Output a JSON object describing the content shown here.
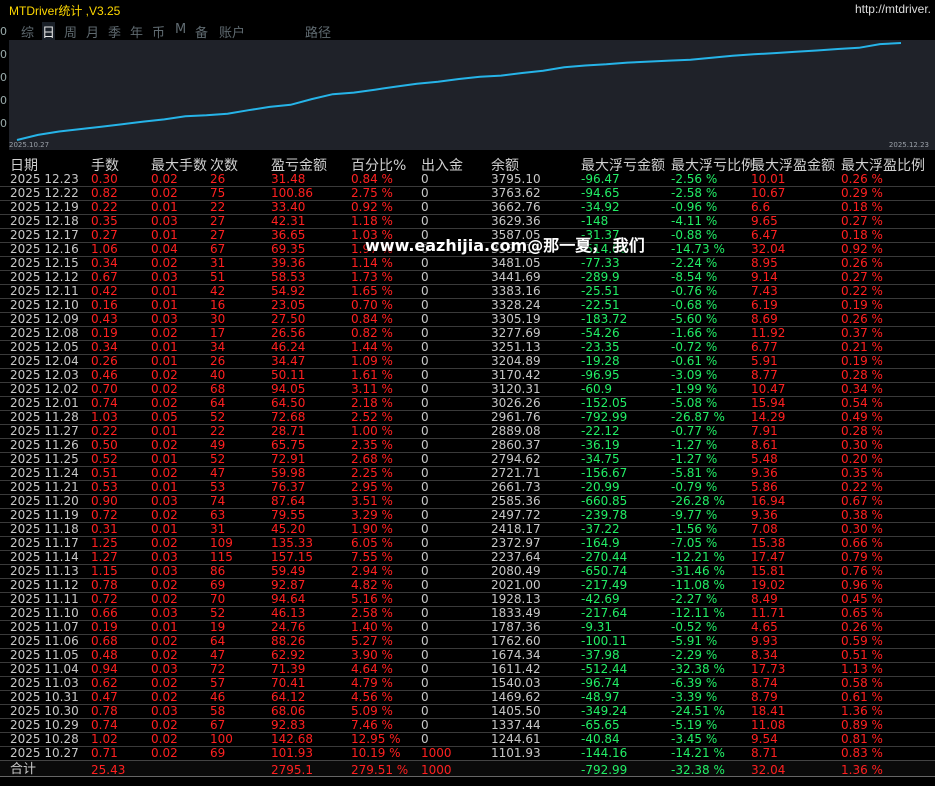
{
  "app": {
    "title": "MTDriver统计 ,V3.25",
    "url": "http://mtdriver."
  },
  "tabs": [
    {
      "label": "综"
    },
    {
      "label": "日",
      "active": true
    },
    {
      "label": "周"
    },
    {
      "label": "月"
    },
    {
      "label": "季"
    },
    {
      "label": "年"
    },
    {
      "label": "币"
    },
    {
      "label": "M"
    },
    {
      "label": "备"
    },
    {
      "label": "账户"
    },
    {
      "label": "路径"
    }
  ],
  "left_axis": [
    "0",
    "0",
    "0",
    "0",
    "0"
  ],
  "chart_data": {
    "type": "line",
    "x_start_label": "2025.10.27",
    "x_end_label": "2025.12.23",
    "line_color": "#26b4e8",
    "series": [
      {
        "values": [
          1101.93,
          1244.61,
          1337.44,
          1405.5,
          1469.62,
          1540.03,
          1611.42,
          1674.34,
          1762.6,
          1787.36,
          1833.49,
          1928.13,
          2021.0,
          2080.49,
          2237.64,
          2372.97,
          2418.17,
          2497.72,
          2585.36,
          2661.73,
          2721.71,
          2794.62,
          2860.37,
          2889.08,
          2961.76,
          3026.26,
          3120.31,
          3170.42,
          3204.89,
          3251.13,
          3277.69,
          3305.19,
          3328.24,
          3383.16,
          3441.69,
          3481.05,
          3514.36,
          3551.14,
          3587.05,
          3629.36,
          3662.76,
          3763.62,
          3795.1
        ]
      }
    ]
  },
  "table": {
    "headers": [
      "日期",
      "手数",
      "最大手数",
      "次数",
      "盈亏金额",
      "百分比%",
      "出入金",
      "余额",
      "最大浮亏金额",
      "最大浮亏比例",
      "最大浮盈金额",
      "最大浮盈比例"
    ],
    "rows": [
      [
        "2025 12.23",
        "0.30",
        "0.02",
        "26",
        "31.48",
        "0.84 %",
        "0",
        "3795.10",
        "-96.47",
        "-2.56 %",
        "10.01",
        "0.26 %"
      ],
      [
        "2025 12.22",
        "0.82",
        "0.02",
        "75",
        "100.86",
        "2.75 %",
        "0",
        "3763.62",
        "-94.65",
        "-2.58 %",
        "10.67",
        "0.29 %"
      ],
      [
        "2025 12.19",
        "0.22",
        "0.01",
        "22",
        "33.40",
        "0.92 %",
        "0",
        "3662.76",
        "-34.92",
        "-0.96 %",
        "6.6",
        "0.18 %"
      ],
      [
        "2025 12.18",
        "0.35",
        "0.03",
        "27",
        "42.31",
        "1.18 %",
        "0",
        "3629.36",
        "-148",
        "-4.11 %",
        "9.65",
        "0.27 %"
      ],
      [
        "2025 12.17",
        "0.27",
        "0.01",
        "27",
        "36.65",
        "1.03 %",
        "0",
        "3587.05",
        "-31.37",
        "-0.88 %",
        "6.47",
        "0.18 %"
      ],
      [
        "2025 12.16",
        "1.06",
        "0.04",
        "67",
        "69.35",
        "1.97 %",
        "0",
        "3551.14",
        "-514.00",
        "-14.73 %",
        "32.04",
        "0.92 %"
      ],
      [
        "2025 12.15",
        "0.34",
        "0.02",
        "31",
        "39.36",
        "1.14 %",
        "0",
        "3481.05",
        "-77.33",
        "-2.24 %",
        "8.95",
        "0.26 %"
      ],
      [
        "2025 12.12",
        "0.67",
        "0.03",
        "51",
        "58.53",
        "1.73 %",
        "0",
        "3441.69",
        "-289.9",
        "-8.54 %",
        "9.14",
        "0.27 %"
      ],
      [
        "2025 12.11",
        "0.42",
        "0.01",
        "42",
        "54.92",
        "1.65 %",
        "0",
        "3383.16",
        "-25.51",
        "-0.76 %",
        "7.43",
        "0.22 %"
      ],
      [
        "2025 12.10",
        "0.16",
        "0.01",
        "16",
        "23.05",
        "0.70 %",
        "0",
        "3328.24",
        "-22.51",
        "-0.68 %",
        "6.19",
        "0.19 %"
      ],
      [
        "2025 12.09",
        "0.43",
        "0.03",
        "30",
        "27.50",
        "0.84 %",
        "0",
        "3305.19",
        "-183.72",
        "-5.60 %",
        "8.69",
        "0.26 %"
      ],
      [
        "2025 12.08",
        "0.19",
        "0.02",
        "17",
        "26.56",
        "0.82 %",
        "0",
        "3277.69",
        "-54.26",
        "-1.66 %",
        "11.92",
        "0.37 %"
      ],
      [
        "2025 12.05",
        "0.34",
        "0.01",
        "34",
        "46.24",
        "1.44 %",
        "0",
        "3251.13",
        "-23.35",
        "-0.72 %",
        "6.77",
        "0.21 %"
      ],
      [
        "2025 12.04",
        "0.26",
        "0.01",
        "26",
        "34.47",
        "1.09 %",
        "0",
        "3204.89",
        "-19.28",
        "-0.61 %",
        "5.91",
        "0.19 %"
      ],
      [
        "2025 12.03",
        "0.46",
        "0.02",
        "40",
        "50.11",
        "1.61 %",
        "0",
        "3170.42",
        "-96.95",
        "-3.09 %",
        "8.77",
        "0.28 %"
      ],
      [
        "2025 12.02",
        "0.70",
        "0.02",
        "68",
        "94.05",
        "3.11 %",
        "0",
        "3120.31",
        "-60.9",
        "-1.99 %",
        "10.47",
        "0.34 %"
      ],
      [
        "2025 12.01",
        "0.74",
        "0.02",
        "64",
        "64.50",
        "2.18 %",
        "0",
        "3026.26",
        "-152.05",
        "-5.08 %",
        "15.94",
        "0.54 %"
      ],
      [
        "2025 11.28",
        "1.03",
        "0.05",
        "52",
        "72.68",
        "2.52 %",
        "0",
        "2961.76",
        "-792.99",
        "-26.87 %",
        "14.29",
        "0.49 %"
      ],
      [
        "2025 11.27",
        "0.22",
        "0.01",
        "22",
        "28.71",
        "1.00 %",
        "0",
        "2889.08",
        "-22.12",
        "-0.77 %",
        "7.91",
        "0.28 %"
      ],
      [
        "2025 11.26",
        "0.50",
        "0.02",
        "49",
        "65.75",
        "2.35 %",
        "0",
        "2860.37",
        "-36.19",
        "-1.27 %",
        "8.61",
        "0.30 %"
      ],
      [
        "2025 11.25",
        "0.52",
        "0.01",
        "52",
        "72.91",
        "2.68 %",
        "0",
        "2794.62",
        "-34.75",
        "-1.27 %",
        "5.48",
        "0.20 %"
      ],
      [
        "2025 11.24",
        "0.51",
        "0.02",
        "47",
        "59.98",
        "2.25 %",
        "0",
        "2721.71",
        "-156.67",
        "-5.81 %",
        "9.36",
        "0.35 %"
      ],
      [
        "2025 11.21",
        "0.53",
        "0.01",
        "53",
        "76.37",
        "2.95 %",
        "0",
        "2661.73",
        "-20.99",
        "-0.79 %",
        "5.86",
        "0.22 %"
      ],
      [
        "2025 11.20",
        "0.90",
        "0.03",
        "74",
        "87.64",
        "3.51 %",
        "0",
        "2585.36",
        "-660.85",
        "-26.28 %",
        "16.94",
        "0.67 %"
      ],
      [
        "2025 11.19",
        "0.72",
        "0.02",
        "63",
        "79.55",
        "3.29 %",
        "0",
        "2497.72",
        "-239.78",
        "-9.77 %",
        "9.36",
        "0.38 %"
      ],
      [
        "2025 11.18",
        "0.31",
        "0.01",
        "31",
        "45.20",
        "1.90 %",
        "0",
        "2418.17",
        "-37.22",
        "-1.56 %",
        "7.08",
        "0.30 %"
      ],
      [
        "2025 11.17",
        "1.25",
        "0.02",
        "109",
        "135.33",
        "6.05 %",
        "0",
        "2372.97",
        "-164.9",
        "-7.05 %",
        "15.38",
        "0.66 %"
      ],
      [
        "2025 11.14",
        "1.27",
        "0.03",
        "115",
        "157.15",
        "7.55 %",
        "0",
        "2237.64",
        "-270.44",
        "-12.21 %",
        "17.47",
        "0.79 %"
      ],
      [
        "2025 11.13",
        "1.15",
        "0.03",
        "86",
        "59.49",
        "2.94 %",
        "0",
        "2080.49",
        "-650.74",
        "-31.46 %",
        "15.81",
        "0.76 %"
      ],
      [
        "2025 11.12",
        "0.78",
        "0.02",
        "69",
        "92.87",
        "4.82 %",
        "0",
        "2021.00",
        "-217.49",
        "-11.08 %",
        "19.02",
        "0.96 %"
      ],
      [
        "2025 11.11",
        "0.72",
        "0.02",
        "70",
        "94.64",
        "5.16 %",
        "0",
        "1928.13",
        "-42.69",
        "-2.27 %",
        "8.49",
        "0.45 %"
      ],
      [
        "2025 11.10",
        "0.66",
        "0.03",
        "52",
        "46.13",
        "2.58 %",
        "0",
        "1833.49",
        "-217.64",
        "-12.11 %",
        "11.71",
        "0.65 %"
      ],
      [
        "2025 11.07",
        "0.19",
        "0.01",
        "19",
        "24.76",
        "1.40 %",
        "0",
        "1787.36",
        "-9.31",
        "-0.52 %",
        "4.65",
        "0.26 %"
      ],
      [
        "2025 11.06",
        "0.68",
        "0.02",
        "64",
        "88.26",
        "5.27 %",
        "0",
        "1762.60",
        "-100.11",
        "-5.91 %",
        "9.93",
        "0.59 %"
      ],
      [
        "2025 11.05",
        "0.48",
        "0.02",
        "47",
        "62.92",
        "3.90 %",
        "0",
        "1674.34",
        "-37.98",
        "-2.29 %",
        "8.34",
        "0.51 %"
      ],
      [
        "2025 11.04",
        "0.94",
        "0.03",
        "72",
        "71.39",
        "4.64 %",
        "0",
        "1611.42",
        "-512.44",
        "-32.38 %",
        "17.73",
        "1.13 %"
      ],
      [
        "2025 11.03",
        "0.62",
        "0.02",
        "57",
        "70.41",
        "4.79 %",
        "0",
        "1540.03",
        "-96.74",
        "-6.39 %",
        "8.74",
        "0.58 %"
      ],
      [
        "2025 10.31",
        "0.47",
        "0.02",
        "46",
        "64.12",
        "4.56 %",
        "0",
        "1469.62",
        "-48.97",
        "-3.39 %",
        "8.79",
        "0.61 %"
      ],
      [
        "2025 10.30",
        "0.78",
        "0.03",
        "58",
        "68.06",
        "5.09 %",
        "0",
        "1405.50",
        "-349.24",
        "-24.51 %",
        "18.41",
        "1.36 %"
      ],
      [
        "2025 10.29",
        "0.74",
        "0.02",
        "67",
        "92.83",
        "7.46 %",
        "0",
        "1337.44",
        "-65.65",
        "-5.19 %",
        "11.08",
        "0.89 %"
      ],
      [
        "2025 10.28",
        "1.02",
        "0.02",
        "100",
        "142.68",
        "12.95 %",
        "0",
        "1244.61",
        "-40.84",
        "-3.45 %",
        "9.54",
        "0.81 %"
      ],
      [
        "2025 10.27",
        "0.71",
        "0.02",
        "69",
        "101.93",
        "10.19 %",
        "1000",
        "1101.93",
        "-144.16",
        "-14.21 %",
        "8.71",
        "0.83 %"
      ]
    ],
    "total": [
      "合计",
      "25.43",
      "",
      "",
      "2795.1",
      "279.51 %",
      "1000",
      "",
      "-792.99",
      "-32.38 %",
      "32.04",
      "1.36 %"
    ]
  },
  "watermark": "www.eazhijia.com@那一夏， 我们"
}
